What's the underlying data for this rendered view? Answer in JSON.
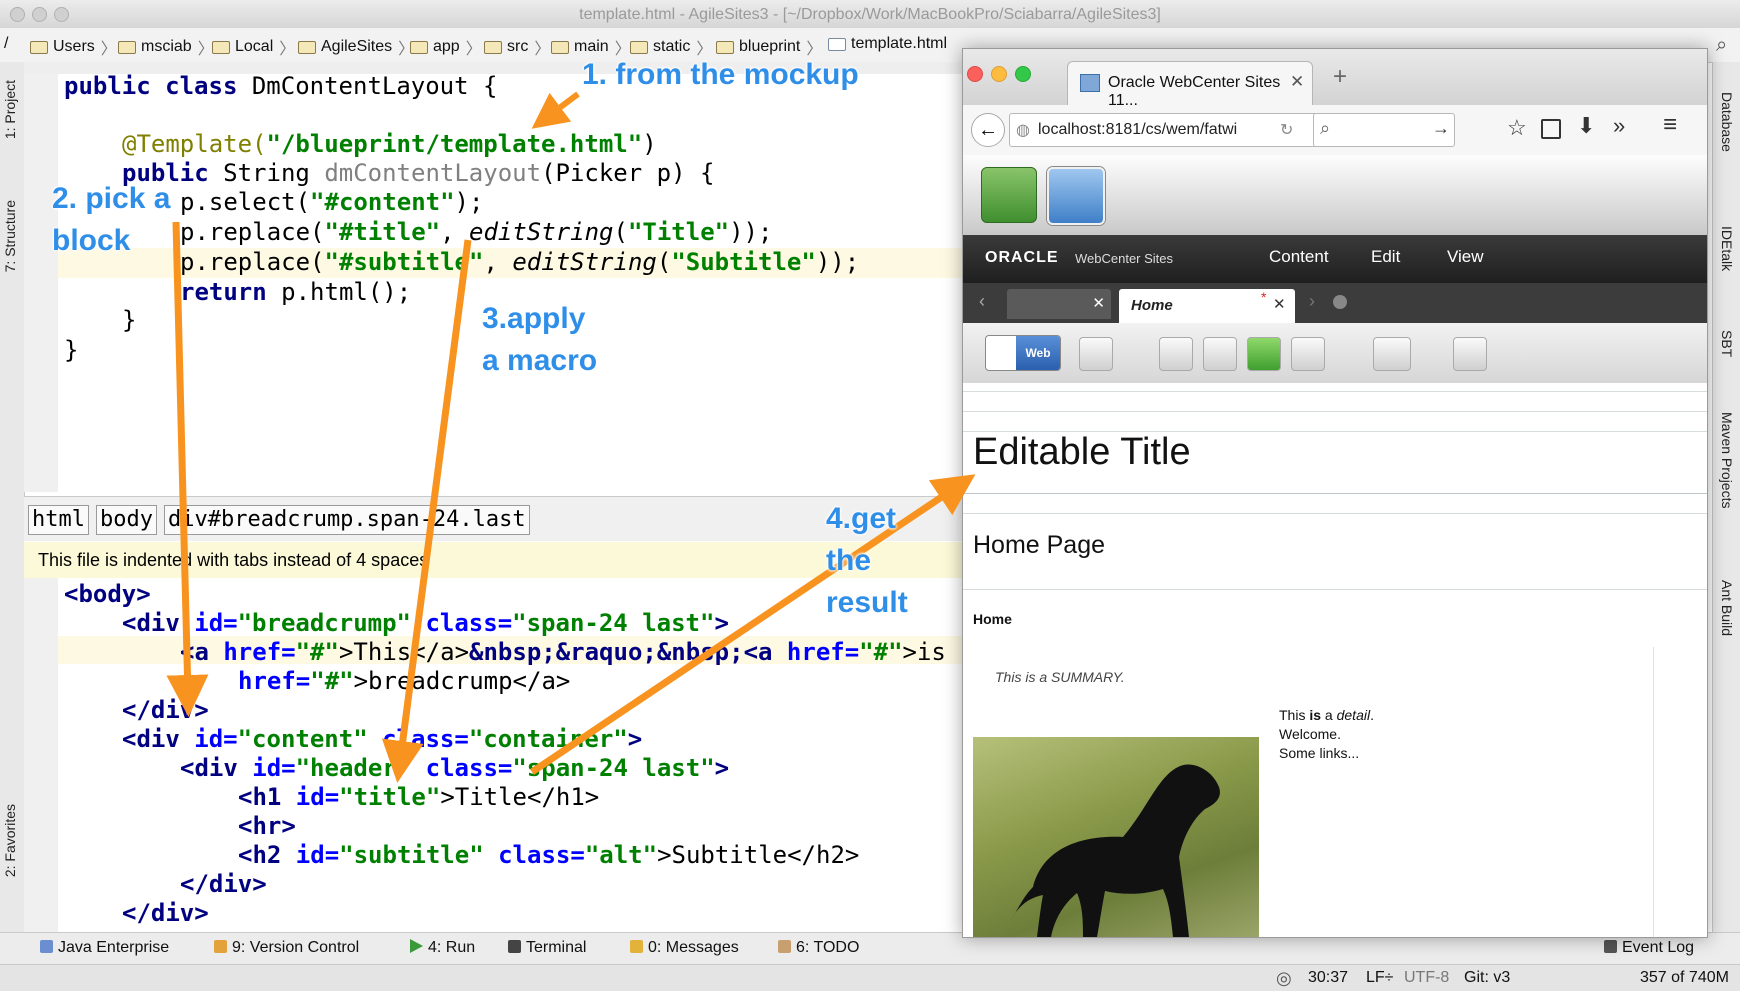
{
  "ide": {
    "title": "template.html - AgileSites3 - [~/Dropbox/Work/MacBookPro/Sciabarra/AgileSites3]",
    "breadcrumb": [
      "Users",
      "msciab",
      "Local",
      "AgileSites",
      "app",
      "src",
      "main",
      "static",
      "blueprint",
      "template.html"
    ],
    "left_tabs": [
      "1: Project",
      "7: Structure",
      "2: Favorites"
    ],
    "right_tabs": [
      "Database",
      "IDEtalk",
      "SBT",
      "Maven Projects",
      "Ant Build"
    ],
    "top_code": {
      "l1": "public class DmContentLayout {",
      "l2a": "@Template(",
      "l2b": "\"/blueprint/template.html\"",
      "l2c": ")",
      "l3a": "public ",
      "l3b": "String ",
      "l3c": "dmContentLayout",
      "l3d": "(Picker p) {",
      "l4a": "p.select(",
      "l4b": "\"#content\"",
      "l4c": ");",
      "l5a": "p.replace(",
      "l5b": "\"#title\"",
      "l5c": ", ",
      "l5d": "editString",
      "l5e": "(",
      "l5f": "\"Title\"",
      "l5g": "));",
      "l6a": "p.replace(",
      "l6b": "\"#subtitle\"",
      "l6c": ", ",
      "l6d": "editString",
      "l6e": "(",
      "l6f": "\"Subtitle\"",
      "l6g": "));",
      "l7a": "return ",
      "l7b": "p.html();",
      "l8": "}",
      "l9": "}"
    },
    "tag_path": [
      "html",
      "body",
      "div#breadcrump.span-24.last"
    ],
    "notice": "This file is indented with tabs instead of 4 spaces",
    "html_code": {
      "b1": "<body>",
      "b2a": "<div ",
      "b2b": "id=",
      "b2c": "\"breadcrump\"",
      "b2d": " class=",
      "b2e": "\"span-24 last\"",
      "b2f": ">",
      "b3a": "<a ",
      "b3b": "href=",
      "b3c": "\"#\"",
      "b3d": ">This</a>",
      "b3e": "&nbsp;&raquo;&nbsp;",
      "b3f": "<a ",
      "b3g": "href=",
      "b3h": "\"#\"",
      "b3i": ">is",
      "b4a": "href=",
      "b4b": "\"#\"",
      "b4c": ">breadcrump</a>",
      "b5": "</div>",
      "b6a": "<div ",
      "b6b": "id=",
      "b6c": "\"content\"",
      "b6d": " class=",
      "b6e": "\"container\"",
      "b6f": ">",
      "b7a": "<div ",
      "b7b": "id=",
      "b7c": "\"header\"",
      "b7d": " class=",
      "b7e": "\"span-24 last\"",
      "b7f": ">",
      "b8a": "<h1 ",
      "b8b": "id=",
      "b8c": "\"title\"",
      "b8d": ">Title</h1>",
      "b9": "<hr>",
      "b10a": "<h2 ",
      "b10b": "id=",
      "b10c": "\"subtitle\"",
      "b10d": " class=",
      "b10e": "\"alt\"",
      "b10f": ">Subtitle</h2>",
      "b11": "</div>",
      "b12": "</div>"
    },
    "tool_windows": [
      "Java Enterprise",
      "9: Version Control",
      "4: Run",
      "Terminal",
      "0: Messages",
      "6: TODO",
      "Event Log"
    ],
    "status": {
      "position": "30:37",
      "line_sep": "LF÷",
      "encoding": "UTF-8",
      "vcs": "Git: v3",
      "memory": "357 of 740M"
    }
  },
  "browser": {
    "tab_title": "Oracle WebCenter Sites 11...",
    "url": "localhost:8181/cs/wem/fatwi",
    "brand": "ORACLE",
    "product": "WebCenter Sites",
    "menu": [
      "Content",
      "Edit",
      "View"
    ],
    "open_tab": "Home",
    "mode_label": "Web",
    "page": {
      "title": "Editable Title",
      "subtitle": "Home Page",
      "breadcrumb": "Home",
      "summary": "This is a SUMMARY.",
      "detail_a": "This ",
      "detail_b": "is",
      "detail_c": " a ",
      "detail_d": "detail",
      "detail_e": ".",
      "welcome": "Welcome.",
      "links": "Some links..."
    }
  },
  "callouts": {
    "c1": "1. from the mockup",
    "c2a": "2. pick a",
    "c2b": "block",
    "c3a": "3.apply",
    "c3b": "a macro",
    "c4a": "4.get",
    "c4b": "the",
    "c4c": "result"
  },
  "colors": {
    "callout_text": "#2f8fe8",
    "arrow": "#f7931e",
    "keyword": "#000080",
    "string": "#008000",
    "annotation": "#808000"
  }
}
